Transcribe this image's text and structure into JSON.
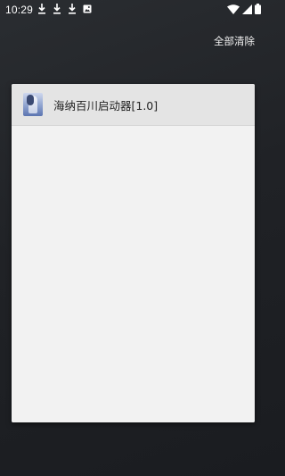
{
  "status_bar": {
    "time": "10:29",
    "left_icons": [
      "download-icon",
      "download-icon",
      "download-icon",
      "photo-icon"
    ],
    "right_icons": [
      "wifi-icon",
      "signal-icon",
      "battery-icon"
    ]
  },
  "header": {
    "clear_all_label": "全部清除"
  },
  "recents": [
    {
      "app_name": "海纳百川启动器[1.0]"
    }
  ]
}
